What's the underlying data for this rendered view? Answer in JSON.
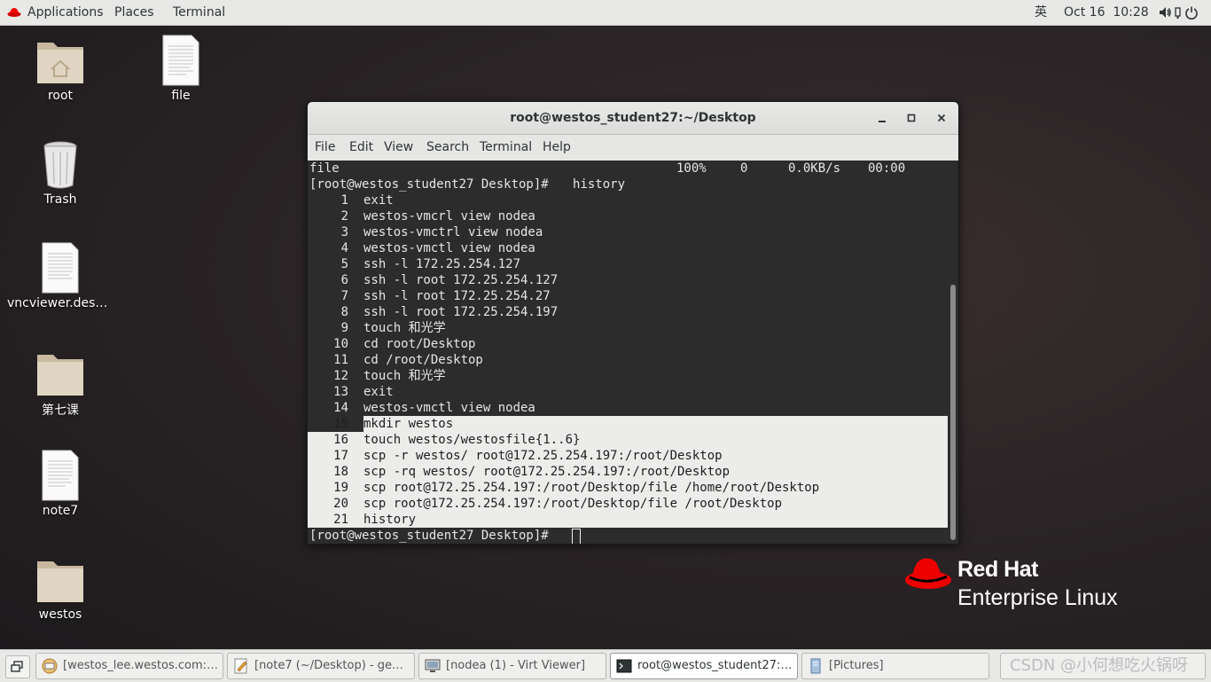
{
  "topbar": {
    "applications": "Applications",
    "places": "Places",
    "terminal": "Terminal",
    "ime": "英",
    "clock": "Oct 16  10:28",
    "icons": [
      "volume-icon",
      "network-icon",
      "power-icon"
    ]
  },
  "desktop": {
    "icons": [
      {
        "label": "root",
        "type": "home-folder-icon"
      },
      {
        "label": "file",
        "type": "document-icon"
      },
      {
        "label": "Trash",
        "type": "trash-icon"
      },
      {
        "label": "vncviewer.deskt…",
        "type": "document-icon"
      },
      {
        "label": "第七课",
        "type": "folder-icon"
      },
      {
        "label": "note7",
        "type": "document-icon"
      },
      {
        "label": "westos",
        "type": "folder-icon"
      }
    ]
  },
  "terminal_window": {
    "title": "root@westos_student27:~/Desktop",
    "menu": [
      "File",
      "Edit",
      "View",
      "Search",
      "Terminal",
      "Help"
    ],
    "transfer_line": {
      "name": "file",
      "percent": "100%",
      "size": "0",
      "rate": "0.0KB/s",
      "time": "00:00"
    },
    "prompt": "[root@westos_student27 Desktop]# ",
    "command": "history",
    "history": [
      {
        "n": "1",
        "cmd": "exit"
      },
      {
        "n": "2",
        "cmd": "westos-vmcrl view nodea"
      },
      {
        "n": "3",
        "cmd": "westos-vmctrl view nodea"
      },
      {
        "n": "4",
        "cmd": "westos-vmctl view nodea"
      },
      {
        "n": "5",
        "cmd": "ssh -l 172.25.254.127"
      },
      {
        "n": "6",
        "cmd": "ssh -l root 172.25.254.127"
      },
      {
        "n": "7",
        "cmd": "ssh -l root 172.25.254.27"
      },
      {
        "n": "8",
        "cmd": "ssh -l root 172.25.254.197"
      },
      {
        "n": "9",
        "cmd": "touch 和光学"
      },
      {
        "n": "10",
        "cmd": "cd root/Desktop"
      },
      {
        "n": "11",
        "cmd": "cd /root/Desktop"
      },
      {
        "n": "12",
        "cmd": "touch 和光学"
      },
      {
        "n": "13",
        "cmd": "exit"
      },
      {
        "n": "14",
        "cmd": "westos-vmctl view nodea"
      },
      {
        "n": "15",
        "cmd": "mkdir westos"
      },
      {
        "n": "16",
        "cmd": "touch westos/westosfile{1..6}"
      },
      {
        "n": "17",
        "cmd": "scp -r westos/ root@172.25.254.197:/root/Desktop"
      },
      {
        "n": "18",
        "cmd": "scp -rq westos/ root@172.25.254.197:/root/Desktop"
      },
      {
        "n": "19",
        "cmd": "scp root@172.25.254.197:/root/Desktop/file /home/root/Desktop"
      },
      {
        "n": "20",
        "cmd": "scp root@172.25.254.197:/root/Desktop/file /root/Desktop"
      },
      {
        "n": "21",
        "cmd": "history"
      }
    ],
    "final_prompt": "[root@westos_student27 Desktop]# "
  },
  "branding": {
    "brand": "Red Hat",
    "product": "Enterprise Linux",
    "color": "#ee0000"
  },
  "taskbar": {
    "tasks": [
      {
        "label": "[westos_lee.westos.com:8 …",
        "icon": "vnc-icon",
        "active": false
      },
      {
        "label": "[note7 (~/Desktop) - gedit]",
        "icon": "text-editor-icon",
        "active": false
      },
      {
        "label": "[nodea (1) - Virt Viewer]",
        "icon": "monitor-icon",
        "active": false
      },
      {
        "label": "root@westos_student27:~…",
        "icon": "terminal-icon",
        "active": true
      },
      {
        "label": "[Pictures]",
        "icon": "file-manager-icon",
        "active": false
      }
    ],
    "watermark": "CSDN @小何想吃火锅呀"
  }
}
